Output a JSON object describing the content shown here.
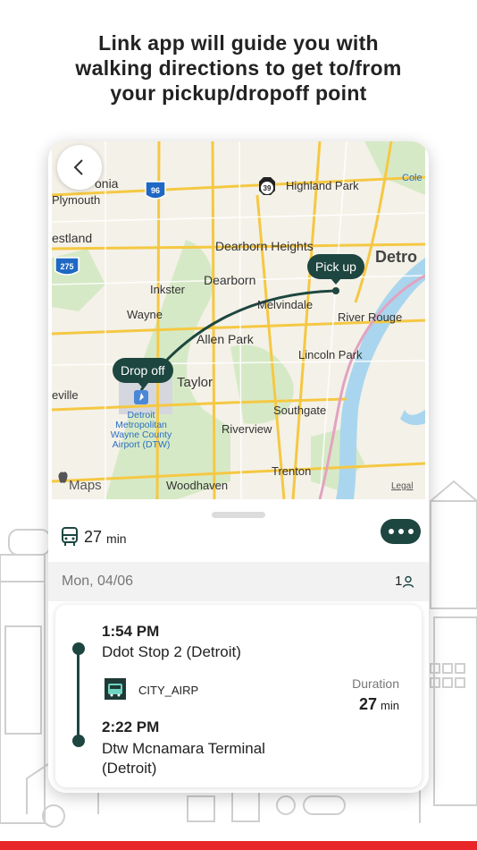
{
  "headline": {
    "line1": "Link app will guide you with",
    "line2": "walking directions to get to/from",
    "line3": "your pickup/dropoff point"
  },
  "colors": {
    "accent": "#1e4640",
    "brand_red": "#e8262a",
    "map_bg": "#f4f1e8",
    "park": "#d6e9c6",
    "water": "#a9d6ee"
  },
  "map": {
    "attribution": "Maps",
    "legal": "Legal",
    "places": [
      {
        "key": "livonia",
        "label": "onia"
      },
      {
        "key": "plymouth",
        "label": "Plymouth"
      },
      {
        "key": "westland",
        "label": "estland"
      },
      {
        "key": "inkster",
        "label": "Inkster"
      },
      {
        "key": "wayne",
        "label": "Wayne"
      },
      {
        "key": "dearborn-heights",
        "label": "Dearborn Heights"
      },
      {
        "key": "dearborn",
        "label": "Dearborn"
      },
      {
        "key": "melvindale",
        "label": "Melvindale"
      },
      {
        "key": "highland-park",
        "label": "Highland Park"
      },
      {
        "key": "detroit",
        "label": "Detro"
      },
      {
        "key": "river-rouge",
        "label": "River Rouge"
      },
      {
        "key": "allen-park",
        "label": "Allen Park"
      },
      {
        "key": "lincoln-park",
        "label": "Lincoln Park"
      },
      {
        "key": "taylor",
        "label": "Taylor"
      },
      {
        "key": "southgate",
        "label": "Southgate"
      },
      {
        "key": "riverview",
        "label": "Riverview"
      },
      {
        "key": "trenton",
        "label": "Trenton"
      },
      {
        "key": "woodhaven",
        "label": "Woodhaven"
      },
      {
        "key": "belleville",
        "label": "eville"
      },
      {
        "key": "cole",
        "label": "Cole"
      },
      {
        "key": "airport1",
        "label": "Detroit"
      },
      {
        "key": "airport2",
        "label": "Metropolitan"
      },
      {
        "key": "airport3",
        "label": "Wayne County"
      },
      {
        "key": "airport4",
        "label": "Airport (DTW)"
      }
    ],
    "shields": [
      "96",
      "275",
      "39"
    ],
    "pickup_label": "Pick up",
    "dropoff_label": "Drop off"
  },
  "trip": {
    "duration_value": "27",
    "duration_unit": "min",
    "date": "Mon, 04/06",
    "passengers": "1",
    "depart_time": "1:54 PM",
    "depart_stop": "Ddot Stop 2 (Detroit)",
    "route_name": "CITY_AIRP",
    "duration_label": "Duration",
    "arrive_time": "2:22 PM",
    "arrive_stop_line1": "Dtw Mcnamara Terminal",
    "arrive_stop_line2": "(Detroit)"
  }
}
